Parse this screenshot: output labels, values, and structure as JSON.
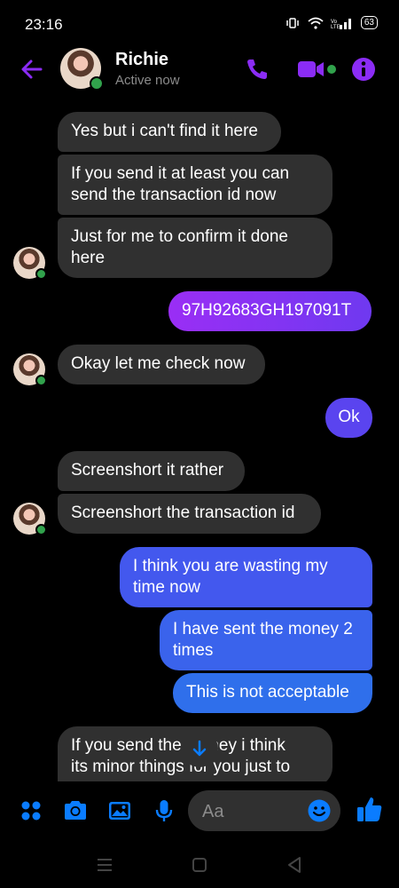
{
  "status_bar": {
    "time": "23:16",
    "battery": "63"
  },
  "header": {
    "contact_name": "Richie",
    "contact_status": "Active now"
  },
  "colors": {
    "accent": "#8b2cf5",
    "accent_blue": "#0a7cff",
    "online": "#31a24c",
    "incoming_bubble": "#303030"
  },
  "messages": [
    {
      "dir": "in",
      "text": "Yes but i can't find it here"
    },
    {
      "dir": "in",
      "text": "If you send it at least you can\nsend the transaction id now"
    },
    {
      "dir": "in",
      "text": "Just for me to confirm it done\nhere"
    },
    {
      "dir": "out",
      "text": "97H92683GH197091T"
    },
    {
      "dir": "in",
      "text": "Okay let me check now"
    },
    {
      "dir": "out",
      "text": "Ok"
    },
    {
      "dir": "in",
      "text": "Screenshort it rather"
    },
    {
      "dir": "in",
      "text": "Screenshort the transaction id"
    },
    {
      "dir": "out",
      "text": "I think you are wasting my\ntime now"
    },
    {
      "dir": "out",
      "text": "I have sent the money 2\ntimes"
    },
    {
      "dir": "out",
      "text": "This is not acceptable"
    },
    {
      "dir": "in",
      "text": "If you send the money i think\nits minor things for you just to"
    }
  ],
  "composer": {
    "placeholder": "Aa"
  },
  "icons": {
    "back": "arrow-left-icon",
    "call": "phone-icon",
    "video": "video-camera-icon",
    "info": "info-icon",
    "menu": "four-dots-icon",
    "camera": "camera-icon",
    "gallery": "image-icon",
    "mic": "microphone-icon",
    "emoji": "emoji-icon",
    "like": "thumbs-up-icon",
    "scroll": "arrow-down-icon"
  }
}
